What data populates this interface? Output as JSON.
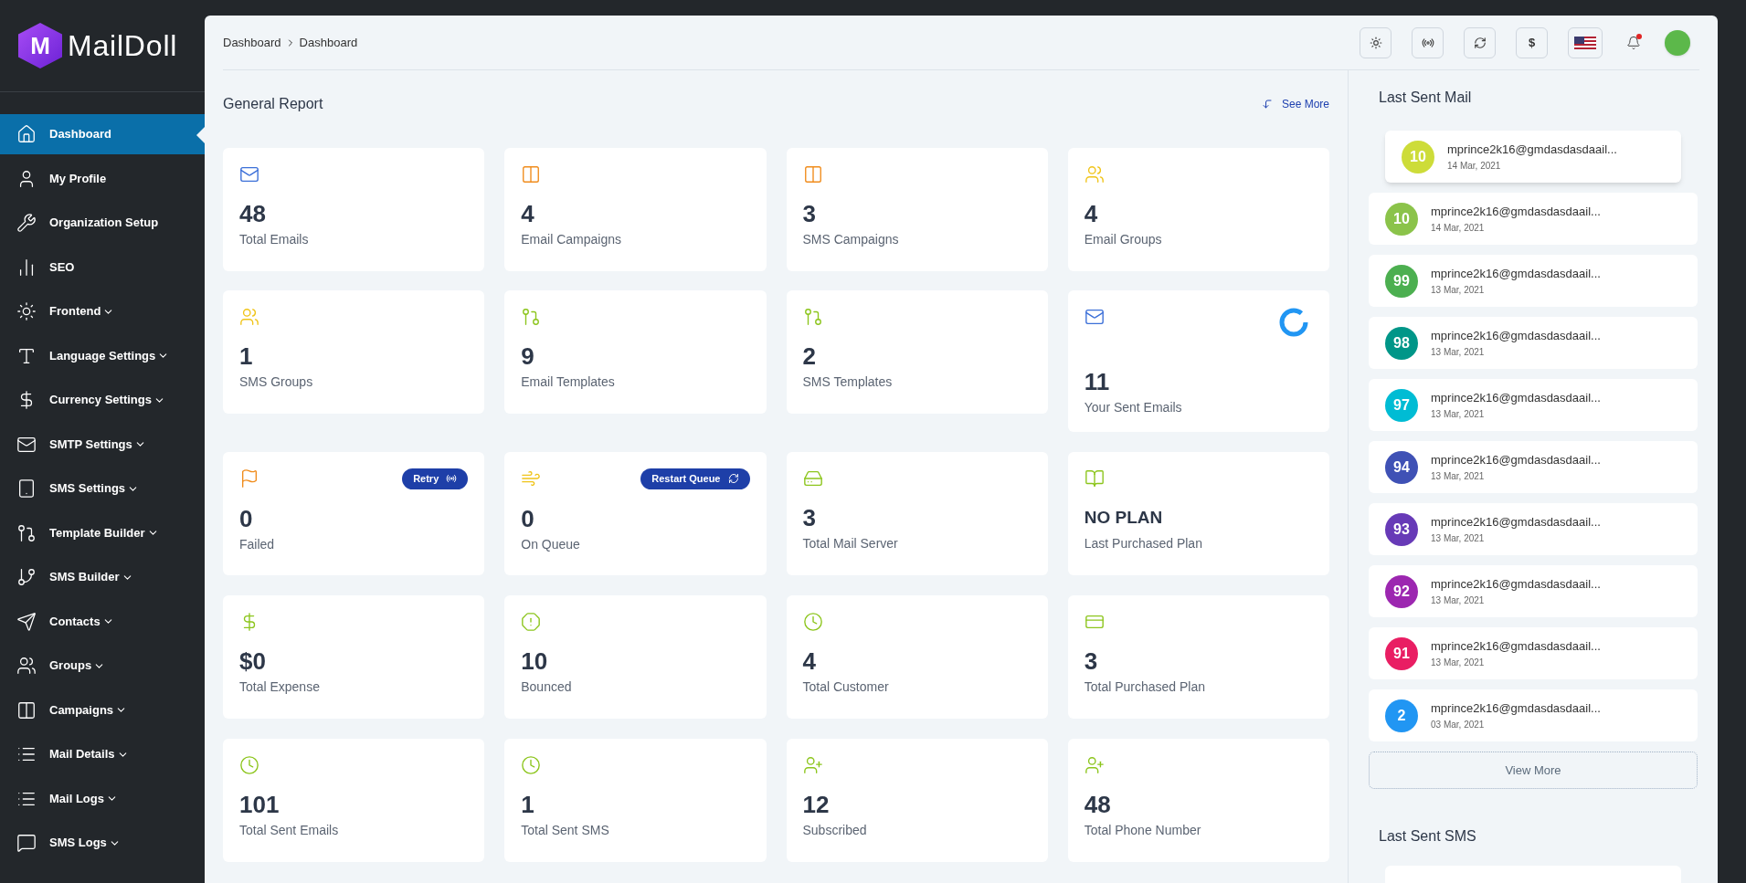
{
  "brand": {
    "mark": "M",
    "name": "MailDoll"
  },
  "sidebar": {
    "items": [
      {
        "label": "Dashboard",
        "selected": true,
        "has_submenu": false
      },
      {
        "label": "My Profile",
        "selected": false,
        "has_submenu": false
      },
      {
        "label": "Organization Setup",
        "selected": false,
        "has_submenu": false
      },
      {
        "label": "SEO",
        "selected": false,
        "has_submenu": false
      },
      {
        "label": "Frontend",
        "selected": false,
        "has_submenu": true
      },
      {
        "label": "Language Settings",
        "selected": false,
        "has_submenu": true
      },
      {
        "label": "Currency Settings",
        "selected": false,
        "has_submenu": true
      },
      {
        "label": "SMTP Settings",
        "selected": false,
        "has_submenu": true
      },
      {
        "label": "SMS Settings",
        "selected": false,
        "has_submenu": true
      },
      {
        "label": "Template Builder",
        "selected": false,
        "has_submenu": true
      },
      {
        "label": "SMS Builder",
        "selected": false,
        "has_submenu": true
      },
      {
        "label": "Contacts",
        "selected": false,
        "has_submenu": true
      },
      {
        "label": "Groups",
        "selected": false,
        "has_submenu": true
      },
      {
        "label": "Campaigns",
        "selected": false,
        "has_submenu": true
      },
      {
        "label": "Mail Details",
        "selected": false,
        "has_submenu": true
      },
      {
        "label": "Mail Logs",
        "selected": false,
        "has_submenu": true
      },
      {
        "label": "SMS Logs",
        "selected": false,
        "has_submenu": true
      }
    ]
  },
  "breadcrumb": [
    "Dashboard",
    "Dashboard"
  ],
  "header": {
    "currency_symbol": "$",
    "notifications_unread": true
  },
  "general_report": {
    "title": "General Report",
    "see_more": "See More",
    "cards": [
      {
        "value": "48",
        "label": "Total Emails"
      },
      {
        "value": "4",
        "label": "Email Campaigns"
      },
      {
        "value": "3",
        "label": "SMS Campaigns"
      },
      {
        "value": "4",
        "label": "Email Groups"
      },
      {
        "value": "1",
        "label": "SMS Groups"
      },
      {
        "value": "9",
        "label": "Email Templates"
      },
      {
        "value": "2",
        "label": "SMS Templates"
      },
      {
        "value": "11",
        "label": "Your Sent Emails",
        "loading": true
      }
    ],
    "cards_2": [
      {
        "value": "0",
        "label": "Failed",
        "action": "Retry"
      },
      {
        "value": "0",
        "label": "On Queue",
        "action": "Restart Queue"
      },
      {
        "value": "3",
        "label": "Total Mail Server"
      },
      {
        "value": "NO PLAN",
        "label": "Last Purchased Plan"
      },
      {
        "value": "$0",
        "label": "Total Expense"
      },
      {
        "value": "10",
        "label": "Bounced"
      },
      {
        "value": "4",
        "label": "Total Customer"
      },
      {
        "value": "3",
        "label": "Total Purchased Plan"
      },
      {
        "value": "101",
        "label": "Total Sent Emails"
      },
      {
        "value": "1",
        "label": "Total Sent SMS"
      },
      {
        "value": "12",
        "label": "Subscribed"
      },
      {
        "value": "48",
        "label": "Total Phone Number"
      }
    ]
  },
  "last_sent_mail": {
    "title": "Last Sent Mail",
    "items": [
      {
        "count": "10",
        "color": "#cddc39",
        "email": "mprince2k16@gmdasdasdaail...",
        "date": "14 Mar, 2021",
        "highlighted": true
      },
      {
        "count": "10",
        "color": "#8bc34a",
        "email": "mprince2k16@gmdasdasdaail...",
        "date": "14 Mar, 2021",
        "highlighted": false
      },
      {
        "count": "99",
        "color": "#4caf50",
        "email": "mprince2k16@gmdasdasdaail...",
        "date": "13 Mar, 2021",
        "highlighted": false
      },
      {
        "count": "98",
        "color": "#009688",
        "email": "mprince2k16@gmdasdasdaail...",
        "date": "13 Mar, 2021",
        "highlighted": false
      },
      {
        "count": "97",
        "color": "#00bcd4",
        "email": "mprince2k16@gmdasdasdaail...",
        "date": "13 Mar, 2021",
        "highlighted": false
      },
      {
        "count": "94",
        "color": "#3f51b5",
        "email": "mprince2k16@gmdasdasdaail...",
        "date": "13 Mar, 2021",
        "highlighted": false
      },
      {
        "count": "93",
        "color": "#673ab7",
        "email": "mprince2k16@gmdasdasdaail...",
        "date": "13 Mar, 2021",
        "highlighted": false
      },
      {
        "count": "92",
        "color": "#9c27b0",
        "email": "mprince2k16@gmdasdasdaail...",
        "date": "13 Mar, 2021",
        "highlighted": false
      },
      {
        "count": "91",
        "color": "#e91e63",
        "email": "mprince2k16@gmdasdasdaail...",
        "date": "13 Mar, 2021",
        "highlighted": false
      },
      {
        "count": "2",
        "color": "#2196f3",
        "email": "mprince2k16@gmdasdasdaail...",
        "date": "03 Mar, 2021",
        "highlighted": false
      }
    ],
    "view_more": "View More"
  },
  "last_sent_sms": {
    "title": "Last Sent SMS"
  }
}
